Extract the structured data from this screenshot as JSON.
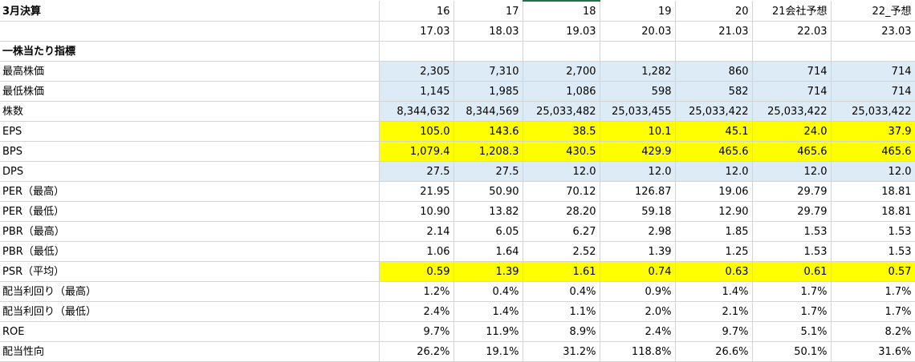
{
  "header": {
    "corner_label": "3月決算",
    "years": [
      "16",
      "17",
      "18",
      "19",
      "20",
      "21会社予想",
      "22_予想"
    ],
    "periods": [
      "17.03",
      "18.03",
      "19.03",
      "20.03",
      "21.03",
      "22.03",
      "23.03"
    ]
  },
  "section_label": "一株当たり指標",
  "colors": {
    "highlight_blue": "#ddebf7",
    "highlight_yellow": "#ffff00",
    "gridline": "#d4d4d4",
    "selection_border": "#217346"
  },
  "rows": [
    {
      "label": "最高株価",
      "bg": "blue",
      "values": [
        "2,305",
        "7,310",
        "2,700",
        "1,282",
        "860",
        "714",
        "714"
      ]
    },
    {
      "label": "最低株価",
      "bg": "blue",
      "values": [
        "1,145",
        "1,985",
        "1,086",
        "598",
        "582",
        "714",
        "714"
      ]
    },
    {
      "label": "株数",
      "bg": "blue",
      "values": [
        "8,344,632",
        "8,344,569",
        "25,033,482",
        "25,033,455",
        "25,033,422",
        "25,033,422",
        "25,033,422"
      ]
    },
    {
      "label": "EPS",
      "bg": "yellow",
      "values": [
        "105.0",
        "143.6",
        "38.5",
        "10.1",
        "45.1",
        "24.0",
        "37.9"
      ]
    },
    {
      "label": "BPS",
      "bg": "yellow",
      "values": [
        "1,079.4",
        "1,208.3",
        "430.5",
        "429.9",
        "465.6",
        "465.6",
        "465.6"
      ]
    },
    {
      "label": "DPS",
      "bg": "blue",
      "values": [
        "27.5",
        "27.5",
        "12.0",
        "12.0",
        "12.0",
        "12.0",
        "12.0"
      ]
    },
    {
      "label": "PER（最高）",
      "bg": "none",
      "values": [
        "21.95",
        "50.90",
        "70.12",
        "126.87",
        "19.06",
        "29.79",
        "18.81"
      ]
    },
    {
      "label": "PER（最低）",
      "bg": "none",
      "values": [
        "10.90",
        "13.82",
        "28.20",
        "59.18",
        "12.90",
        "29.79",
        "18.81"
      ]
    },
    {
      "label": "PBR（最高）",
      "bg": "none",
      "values": [
        "2.14",
        "6.05",
        "6.27",
        "2.98",
        "1.85",
        "1.53",
        "1.53"
      ]
    },
    {
      "label": "PBR（最低）",
      "bg": "none",
      "values": [
        "1.06",
        "1.64",
        "2.52",
        "1.39",
        "1.25",
        "1.53",
        "1.53"
      ]
    },
    {
      "label": "PSR（平均）",
      "bg": "yellow",
      "values": [
        "0.59",
        "1.39",
        "1.61",
        "0.74",
        "0.63",
        "0.61",
        "0.57"
      ]
    },
    {
      "label": "配当利回り（最高）",
      "bg": "none",
      "values": [
        "1.2%",
        "0.4%",
        "0.4%",
        "0.9%",
        "1.4%",
        "1.7%",
        "1.7%"
      ]
    },
    {
      "label": "配当利回り（最低）",
      "bg": "none",
      "values": [
        "2.4%",
        "1.4%",
        "1.1%",
        "2.0%",
        "2.1%",
        "1.7%",
        "1.7%"
      ]
    },
    {
      "label": "ROE",
      "bg": "none",
      "values": [
        "9.7%",
        "11.9%",
        "8.9%",
        "2.4%",
        "9.7%",
        "5.1%",
        "8.2%"
      ]
    },
    {
      "label": "配当性向",
      "bg": "none",
      "values": [
        "26.2%",
        "19.1%",
        "31.2%",
        "118.8%",
        "26.6%",
        "50.1%",
        "31.6%"
      ]
    }
  ]
}
